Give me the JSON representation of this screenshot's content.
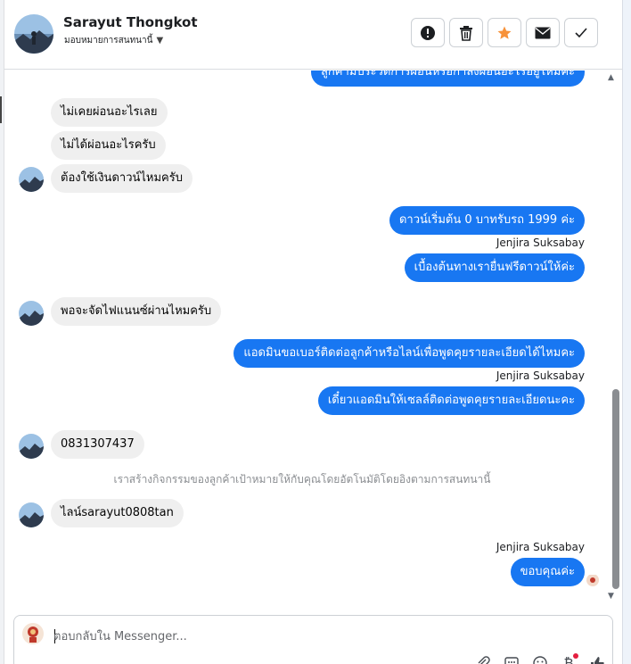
{
  "contact": {
    "name": "Sarayut Thongkot",
    "assign_label": "มอบหมายการสนทนานี้"
  },
  "header_actions": [
    {
      "icon": "alert-circle-icon",
      "color": "#1c1e21"
    },
    {
      "icon": "trash-icon",
      "color": "#1c1e21"
    },
    {
      "icon": "star-icon",
      "color": "#f7923a"
    },
    {
      "icon": "envelope-icon",
      "color": "#1c1e21"
    },
    {
      "icon": "check-icon",
      "color": "#1c1e21"
    }
  ],
  "messages": {
    "m0_partial": "ลูกค้ามีประวัติการผ่อนหรือกำลังผ่อนอะไรอยู่ไหมคะ",
    "m1": "ไม่เคยผ่อนอะไรเลย",
    "m2": "ไม่ได้ผ่อนอะไรครับ",
    "m3": "ต้องใช้เงินดาวน์ไหมครับ",
    "m4": "ดาวน์เริ่มต้น 0 บาทรับรถ 1999 ค่ะ",
    "m5": "เบื้องต้นทางเรายื่นฟรีดาวน์ให้ค่ะ",
    "m6": "พอจะจัดไฟแนนซ์ผ่านไหมครับ",
    "m7": "แอดมินขอเบอร์ติดต่อลูกค้าหรือไลน์เพื่อพูดคุยรายละเอียดได้ไหมคะ",
    "m8": "เดี๋ยวแอดมินให้เซลล์ติดต่อพูดคุยรายละเอียดนะคะ",
    "m9": "0831307437",
    "m10": "ไลน์sarayut0808tan",
    "m11": "ขอบคุณค่ะ"
  },
  "sender_name": "Jenjira Suksabay",
  "system_notice": "เราสร้างกิจกรรมของลูกค้าเป้าหมายให้กับคุณโดยอัตโนมัติโดยอิงตามการสนทนานี้",
  "composer": {
    "placeholder": "ตอบกลับใน Messenger...",
    "value": ""
  },
  "composer_tools": [
    "paperclip-icon",
    "saved-replies-icon",
    "emoji-icon",
    "currency-icon",
    "thumbs-up-icon"
  ],
  "colors": {
    "outgoing_bubble": "#1877f2",
    "incoming_bubble": "#efefef",
    "star_active": "#f7923a",
    "notification_dot": "#e41e3f"
  }
}
